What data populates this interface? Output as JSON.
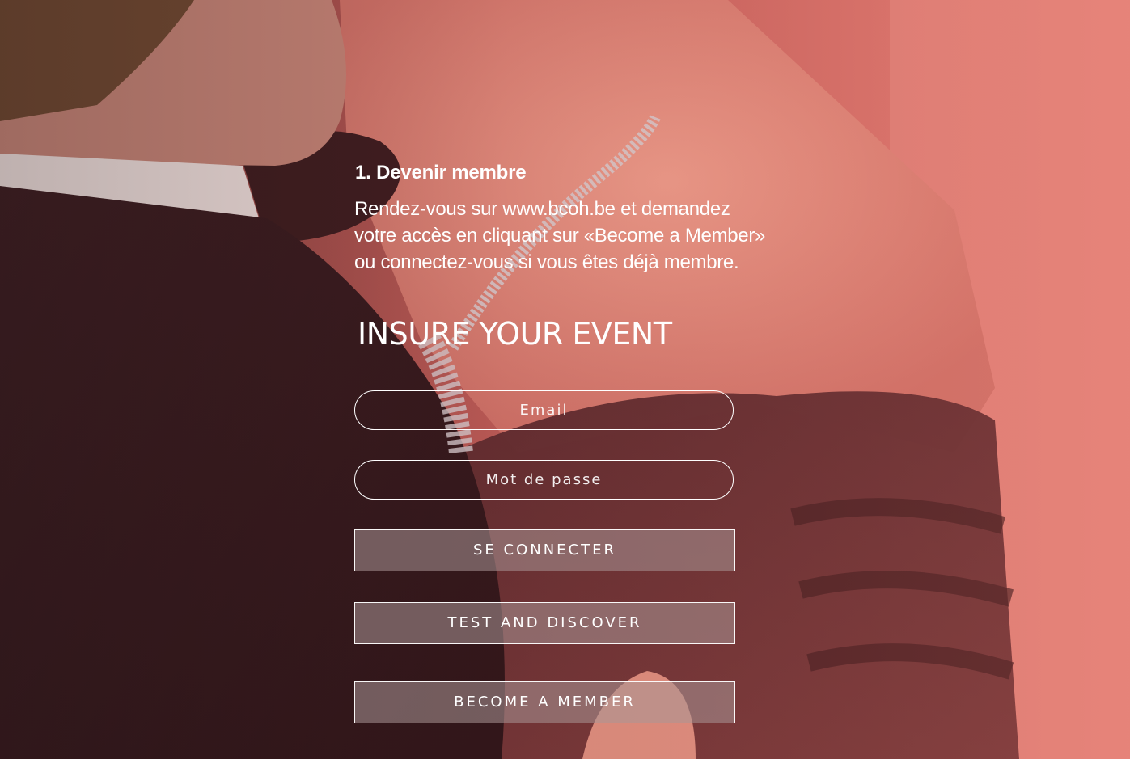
{
  "step": {
    "title": "1. Devenir membre",
    "text_line1": "Rendez-vous sur www.bcoh.be et demandez",
    "text_line2": "votre accès en cliquant sur «Become a Member»",
    "text_line3": "ou connectez-vous si vous êtes déjà membre."
  },
  "login": {
    "heading": "INSURE YOUR EVENT",
    "email_placeholder": "Email",
    "password_placeholder": "Mot de passe",
    "login_label": "SE CONNECTER",
    "test_label": "TEST AND DISCOVER",
    "member_label": "BECOME A MEMBER"
  },
  "colors": {
    "overlay_tint": "#e0736a",
    "text": "#ffffff"
  }
}
